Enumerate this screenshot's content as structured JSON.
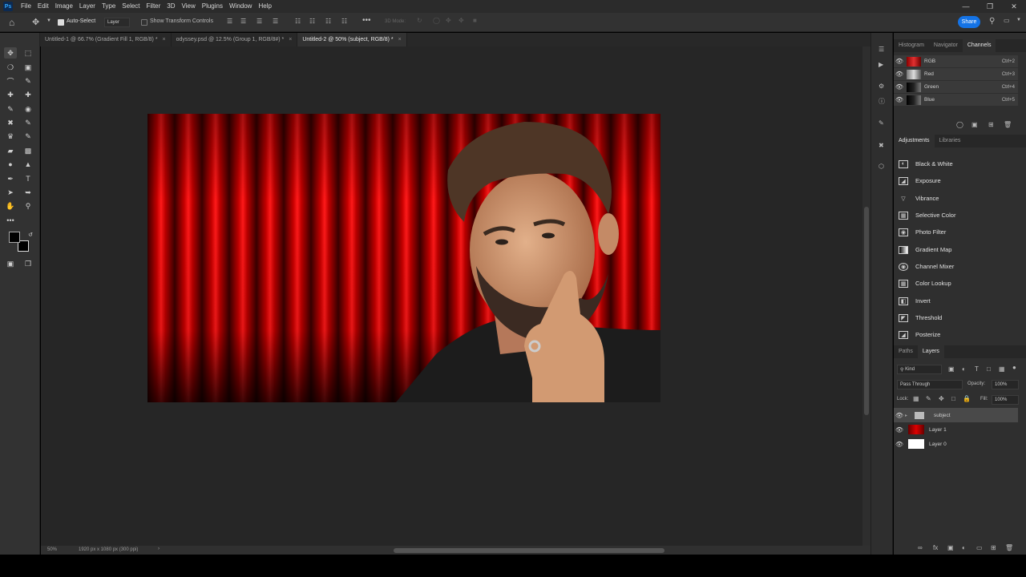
{
  "app": {
    "logo": "Ps"
  },
  "menu": [
    "File",
    "Edit",
    "Image",
    "Layer",
    "Type",
    "Select",
    "Filter",
    "3D",
    "View",
    "Plugins",
    "Window",
    "Help"
  ],
  "options": {
    "auto_select_label": "Auto-Select",
    "auto_select_value": "Layer",
    "transform_label": "Show Transform Controls",
    "mode_3d": "3D Mode:",
    "share": "Share"
  },
  "tabs": [
    {
      "label": "Untitled-1 @ 66.7% (Gradient Fill 1, RGB/8) *",
      "close": "×"
    },
    {
      "label": "odyssey.psd @ 12.5% (Group 1, RGB/8#) *",
      "close": "×"
    },
    {
      "label": "Untitled-2 @ 50% (subject, RGB/8) *",
      "close": "×"
    }
  ],
  "status": {
    "zoom": "50%",
    "doc_info": "1920 px x 1080 px (300 ppi)"
  },
  "panels": {
    "top_tabs": [
      "Histogram",
      "Navigator",
      "Channels"
    ],
    "channels": [
      {
        "name": "RGB",
        "shortcut": "Ctrl+2"
      },
      {
        "name": "Red",
        "shortcut": "Ctrl+3"
      },
      {
        "name": "Green",
        "shortcut": "Ctrl+4"
      },
      {
        "name": "Blue",
        "shortcut": "Ctrl+5"
      }
    ],
    "mid_tabs": [
      "Adjustments",
      "Libraries"
    ],
    "adjustments": [
      "Black & White",
      "Exposure",
      "Vibrance",
      "Selective Color",
      "Photo Filter",
      "Gradient Map",
      "Channel Mixer",
      "Color Lookup",
      "Invert",
      "Threshold",
      "Posterize"
    ],
    "bottom_tabs": [
      "Paths",
      "Layers"
    ],
    "layers_filter": "Kind",
    "blend_mode": "Pass Through",
    "opacity_label": "Opacity:",
    "opacity": "100%",
    "lock_label": "Lock:",
    "fill_label": "Fill:",
    "fill": "100%",
    "layers": [
      "subject",
      "Layer 1",
      "Layer 0"
    ]
  },
  "colors": {
    "accent": "#1473e6",
    "curtain": "#c00000",
    "panel": "#2f2f2f"
  }
}
